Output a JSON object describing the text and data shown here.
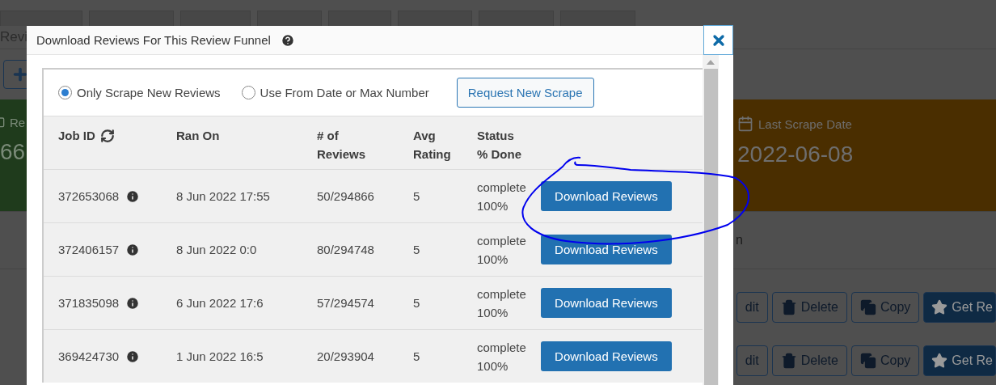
{
  "page": {
    "title": "Revi",
    "cards": [
      {
        "color": "#1f3b1c",
        "label": "Re",
        "value": "66"
      },
      {
        "color": "#4a2e00",
        "label": "Last Scrape Date",
        "value": "2022-06-08"
      }
    ],
    "list_text": "n",
    "action_rows": [
      {
        "buttons": [
          {
            "kind": "edit",
            "label": "dit"
          },
          {
            "kind": "delete",
            "label": "Delete"
          },
          {
            "kind": "copy",
            "label": "Copy"
          },
          {
            "kind": "primary",
            "label": "Get Re"
          }
        ]
      },
      {
        "buttons": [
          {
            "kind": "edit",
            "label": "dit"
          },
          {
            "kind": "delete",
            "label": "Delete"
          },
          {
            "kind": "copy",
            "label": "Copy"
          },
          {
            "kind": "primary",
            "label": "Get Re"
          }
        ]
      }
    ]
  },
  "modal": {
    "title": "Download Reviews For This Review Funnel",
    "options": [
      {
        "label": "Only Scrape New Reviews",
        "selected": true
      },
      {
        "label": "Use From Date or Max Number",
        "selected": false
      }
    ],
    "request_button": "Request New Scrape",
    "columns": [
      [
        "Job ID"
      ],
      [
        "Ran On"
      ],
      [
        "# of",
        "Reviews"
      ],
      [
        "Avg",
        "Rating"
      ],
      [
        "Status",
        "% Done"
      ]
    ],
    "rows": [
      {
        "job_id": "372653068",
        "ran_on": "8 Jun 2022 17:55",
        "reviews": "50/294866",
        "rating": "5",
        "status": "complete",
        "done": "100%",
        "button": "Download Reviews"
      },
      {
        "job_id": "372406157",
        "ran_on": "8 Jun 2022 0:0",
        "reviews": "80/294748",
        "rating": "5",
        "status": "complete",
        "done": "100%",
        "button": "Download Reviews"
      },
      {
        "job_id": "371835098",
        "ran_on": "6 Jun 2022 17:6",
        "reviews": "57/294574",
        "rating": "5",
        "status": "complete",
        "done": "100%",
        "button": "Download Reviews"
      },
      {
        "job_id": "369424730",
        "ran_on": "1 Jun 2022 16:5",
        "reviews": "20/293904",
        "rating": "5",
        "status": "complete",
        "done": "100%",
        "button": "Download Reviews"
      }
    ]
  }
}
